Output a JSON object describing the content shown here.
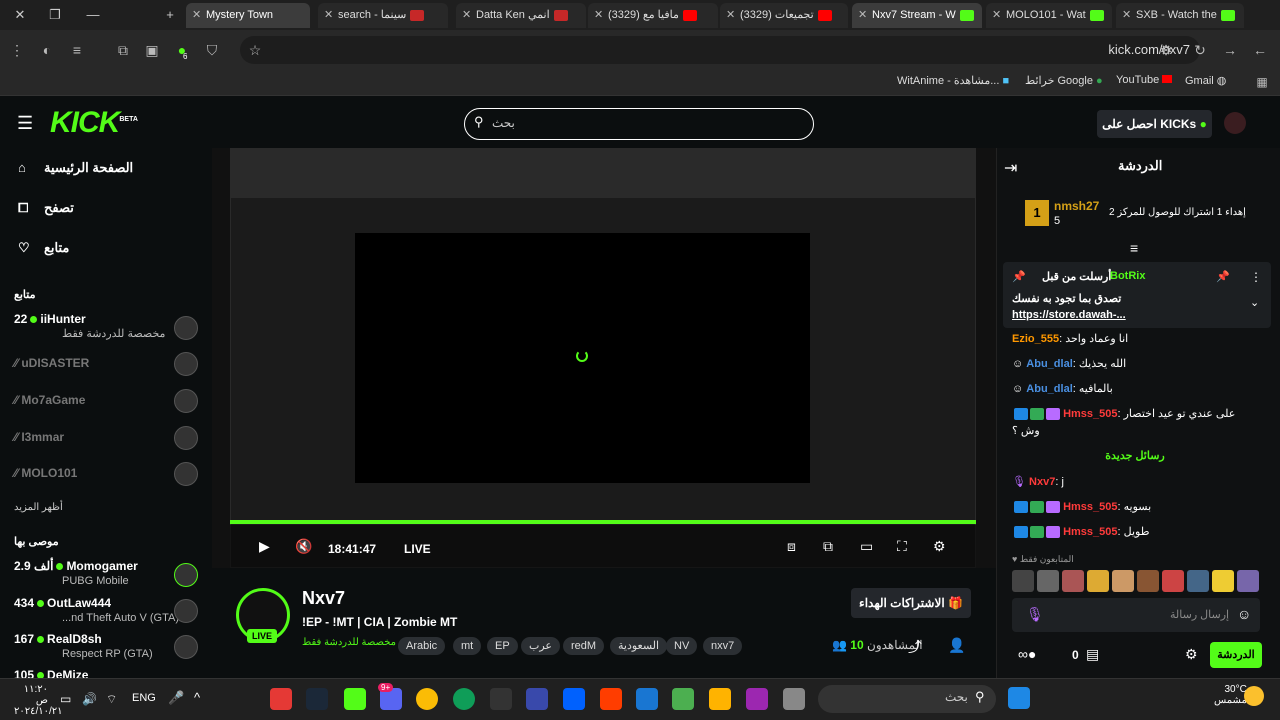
{
  "browser": {
    "tabs": [
      {
        "label": "Mystery Town",
        "favicon": "top-icon"
      },
      {
        "label": "search - سينما",
        "favicon": "top-icon"
      },
      {
        "label": "Datta Ken انمي",
        "favicon": "top-icon"
      },
      {
        "label": "(3329) مافيا مع",
        "favicon": "youtube-icon"
      },
      {
        "label": "(3329) تجميعات",
        "favicon": "youtube-icon"
      },
      {
        "label": "Nxv7 Stream - W",
        "favicon": "kick-icon"
      },
      {
        "label": "MOLO101 - Wat",
        "favicon": "kick-icon"
      },
      {
        "label": "SXB - Watch the",
        "favicon": "kick-icon"
      }
    ],
    "url": "kick.com/nxv7",
    "extension_badge": "6",
    "bookmarks": [
      "Gmail",
      "YouTube",
      "خرائط Google",
      "WitAnime - مشاهدة..."
    ]
  },
  "kick": {
    "logo": "KICK",
    "logo_badge": "BETA",
    "search_placeholder": "بحث",
    "get_kicks": "احصل على KICKs"
  },
  "sidebar": {
    "nav": [
      "الصفحة الرئيسية",
      "تصفح",
      "متابع"
    ],
    "following_head": "متابع",
    "following": [
      {
        "name": "iiHunter",
        "viewers": "22",
        "sub": "مخصصة للدردشة فقط",
        "live": true
      },
      {
        "name": "uDISASTER",
        "live": false
      },
      {
        "name": "Mo7aGame",
        "live": false
      },
      {
        "name": "I3mmar",
        "live": false
      },
      {
        "name": "MOLO101",
        "live": false
      }
    ],
    "show_more": "أظهر المزيد",
    "recommended_head": "موصى بها",
    "recommended": [
      {
        "name": "Momogamer",
        "viewers": "2.9 ألف",
        "sub": "PUBG Mobile"
      },
      {
        "name": "OutLaw444",
        "viewers": "434",
        "sub": "...nd Theft Auto V (GTA)"
      },
      {
        "name": "RealD8sh",
        "viewers": "167",
        "sub": "Respect RP (GTA)"
      },
      {
        "name": "DeMize",
        "viewers": "105",
        "sub": ""
      }
    ]
  },
  "player": {
    "time": "18:41:47",
    "live_label": "LIVE"
  },
  "stream": {
    "name": "Nxv7",
    "title": "!EP - !MT | CIA | Zombie MT",
    "category": "مخصصة للدردشة فقط",
    "live_badge": "LIVE",
    "tags": [
      "Arabic",
      "mt",
      "EP",
      "عرب",
      "redM",
      "السعودية",
      "NV",
      "nxv7"
    ],
    "subs_button": "الاشتراكات الهداء",
    "viewers_count": "10",
    "viewers_label": "المشاهدون"
  },
  "chat": {
    "title": "الدردشة",
    "leader": {
      "name": "nmsh27",
      "rank": "1",
      "count": "5",
      "gift_text": "إهداء 1 اشتراك للوصول للمركز 2"
    },
    "pinned": {
      "label": "أرسلت من قبل",
      "user": "BotRix",
      "text": "تصدق بما تجود به نفسك",
      "link": "https://store.dawah-..."
    },
    "messages": [
      {
        "user": "Ezio_555",
        "text": "انا وعماد واحد",
        "color": "#ff9800"
      },
      {
        "user": "Abu_dlal",
        "text": "الله يحذيك",
        "color": "#4a90e2"
      },
      {
        "user": "Abu_dlal",
        "text": "بالمافيه",
        "color": "#4a90e2"
      },
      {
        "user": "Hmss_505",
        "text": "على عندي تو عيد اختصار",
        "color": "#ff3b3b"
      }
    ],
    "emote_line": "وش ؟",
    "new_messages": "رسائل جديدة",
    "new": [
      {
        "user": "Nxv7",
        "text": "j",
        "color": "#ff3b3b"
      },
      {
        "user": "Hmss_505",
        "text": "بسويه",
        "color": "#ff3b3b"
      },
      {
        "user": "Hmss_505",
        "text": "طويل",
        "color": "#ff3b3b"
      }
    ],
    "viewers_only": "المتابعون فقط",
    "input_placeholder": "إرسال رسالة",
    "points": "0",
    "send_button": "الدردشة"
  },
  "taskbar": {
    "search": "بحث",
    "lang": "ENG",
    "time": "١١:٢٠ ص",
    "date": "٢٠٢٤/١٠/٢١",
    "weather_temp": "30°C",
    "weather_desc": "مشمس",
    "discord_badge": "9+"
  }
}
